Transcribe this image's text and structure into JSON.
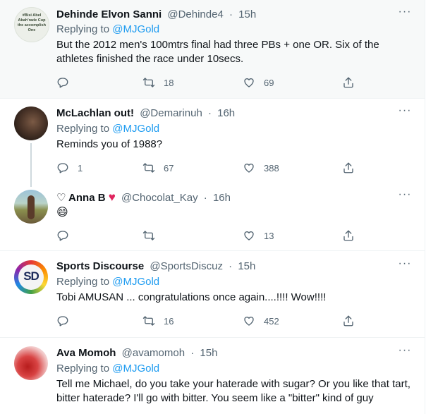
{
  "tweets": [
    {
      "name": "Dehinde Elvon Sanni",
      "handle": "@Dehinde4",
      "time": "15h",
      "replying_prefix": "Replying to ",
      "replying_to": "@MJGold",
      "text": "But the 2012 men's 100mtrs final had three PBs + one OR. Six of the athletes finished the race under 10secs.",
      "replies": "",
      "retweets": "18",
      "likes": "69",
      "avatar_text": "#Bisi Abel Abah'rade Cup\nthe accomplish\nOne"
    },
    {
      "name": "McLachlan out!",
      "handle": "@Demarinuh",
      "time": "16h",
      "replying_prefix": "Replying to ",
      "replying_to": "@MJGold",
      "text": "Reminds you of 1988?",
      "replies": "1",
      "retweets": "67",
      "likes": "388"
    },
    {
      "name_prefix": "♡ Anna B",
      "name_suffix": "♥",
      "handle": "@Chocolat_Kay",
      "time": "16h",
      "text": "😄",
      "replies": "",
      "retweets": "",
      "likes": "13"
    },
    {
      "name": "Sports Discourse",
      "handle": "@SportsDiscuz",
      "time": "15h",
      "replying_prefix": "Replying to ",
      "replying_to": "@MJGold",
      "text": "Tobi AMUSAN ... congratulations once again....!!!! Wow!!!!",
      "replies": "",
      "retweets": "16",
      "likes": "452",
      "avatar_text": "SD"
    },
    {
      "name": "Ava Momoh",
      "handle": "@avamomoh",
      "time": "15h",
      "replying_prefix": "Replying to ",
      "replying_to": "@MJGold",
      "text": "Tell me Michael, do you take your haterade with sugar? Or you like that tart, bitter haterade? I'll go with bitter. You seem like a \"bitter\" kind of guy"
    }
  ],
  "more_glyph": "···",
  "dot": "·",
  "colors": {
    "link": "#1d9bf0",
    "muted": "#536471",
    "heart": "#e0245e",
    "highlight_bg": "#f7f9f9"
  },
  "icons": [
    "reply-icon",
    "retweet-icon",
    "like-icon",
    "share-icon",
    "more-icon",
    "heart-emoji-icon"
  ]
}
